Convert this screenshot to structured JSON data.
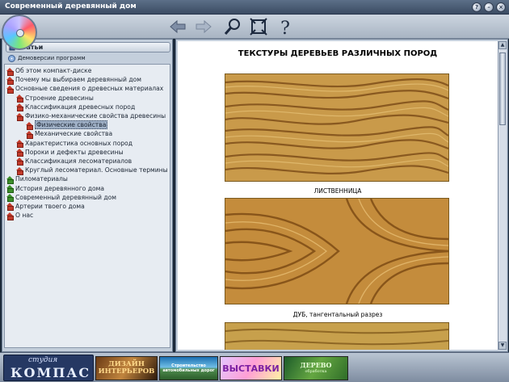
{
  "window": {
    "title": "Современный деревянный дом"
  },
  "toolbar": {
    "buttons": [
      {
        "name": "back-button",
        "icon": "back-arrow-icon"
      },
      {
        "name": "forward-button",
        "icon": "forward-arrow-icon"
      },
      {
        "name": "search-button",
        "icon": "magnifier-icon"
      },
      {
        "name": "fullscreen-button",
        "icon": "fullscreen-icon"
      },
      {
        "name": "help-button",
        "icon": "question-icon"
      }
    ]
  },
  "sidebar": {
    "tab_articles": "Статьи",
    "tab_demo": "Демоверсии программ",
    "items": [
      {
        "label": "Об этом компакт-диске",
        "level": 0,
        "icon": "house-red"
      },
      {
        "label": "Почему мы выбираем деревянный дом",
        "level": 0,
        "icon": "house-red"
      },
      {
        "label": "Основные сведения о древесных материалах",
        "level": 0,
        "icon": "house-red"
      },
      {
        "label": "Строение древесины",
        "level": 1,
        "icon": "house-red"
      },
      {
        "label": "Классификация древесных пород",
        "level": 1,
        "icon": "house-red"
      },
      {
        "label": "Физико-механические свойства древесины",
        "level": 1,
        "icon": "house-red"
      },
      {
        "label": "Физические свойства",
        "level": 2,
        "icon": "house-red",
        "selected": true
      },
      {
        "label": "Механические свойства",
        "level": 2,
        "icon": "house-red"
      },
      {
        "label": "Характеристика основных пород",
        "level": 1,
        "icon": "house-red"
      },
      {
        "label": "Пороки и дефекты древесины",
        "level": 1,
        "icon": "house-red"
      },
      {
        "label": "Классификация лесоматериалов",
        "level": 1,
        "icon": "house-red"
      },
      {
        "label": "Круглый лесоматериал. Основные термины",
        "level": 1,
        "icon": "house-red"
      },
      {
        "label": "Пиломатериалы",
        "level": 0,
        "icon": "house-green"
      },
      {
        "label": "История деревянного дома",
        "level": 0,
        "icon": "house-green"
      },
      {
        "label": "Современный деревянный дом",
        "level": 0,
        "icon": "house-green"
      },
      {
        "label": "Артерии твоего дома",
        "level": 0,
        "icon": "house-red"
      },
      {
        "label": "О нас",
        "level": 0,
        "icon": "house-red"
      }
    ]
  },
  "content": {
    "heading": "ТЕКСТУРЫ ДЕРЕВЬЕВ РАЗЛИЧНЫХ ПОРОД",
    "images": [
      {
        "caption": "ЛИСТВЕННИЦА",
        "texture": "larch"
      },
      {
        "caption": "ДУБ, тангентальный разрез",
        "texture": "oak"
      },
      {
        "caption": "",
        "texture": "partial"
      }
    ]
  },
  "footer": {
    "logo_top": "студия",
    "logo_main": "КОМПАС",
    "banners": {
      "design": "ДИЗАЙН ИНТЕРЬЕРОВ",
      "road": "Строительство автомобильных дорог",
      "expo": "ВЫСТАВКИ",
      "wood_main": "ДЕРЕВО",
      "wood_sub": "обработка"
    }
  }
}
